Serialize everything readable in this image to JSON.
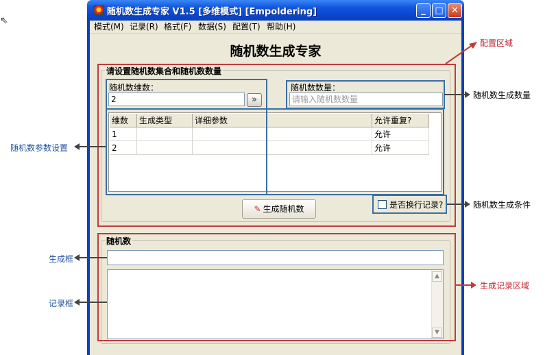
{
  "window": {
    "title": "随机数生成专家 V1.5 [多维模式] [Empoldering]",
    "min_glyph": "_",
    "max_glyph": "□",
    "close_glyph": "✕"
  },
  "menu": [
    "模式(M)",
    "记录(R)",
    "格式(F)",
    "数据(S)",
    "配置(T)",
    "帮助(H)"
  ],
  "app_title": "随机数生成专家",
  "config_group": {
    "legend": "请设置随机数集合和随机数数量",
    "dimension_label": "随机数维数：",
    "dimension_value": "2",
    "go_glyph": "»",
    "count_label": "随机数数量：",
    "count_placeholder": "请输入随机数数量"
  },
  "table": {
    "headers": [
      "维数",
      "生成类型",
      "详细参数",
      "允许重复?"
    ],
    "rows": [
      [
        "1",
        "",
        "",
        "允许"
      ],
      [
        "2",
        "",
        "",
        "允许"
      ]
    ]
  },
  "generate_button": "生成随机数",
  "generate_icon_glyph": "✎",
  "newline_checkbox": {
    "label": "是否换行记录?",
    "checked": false
  },
  "result_group": {
    "legend": "随机数"
  },
  "annotations": {
    "config_area": "配置区域",
    "count": "随机数生成数量",
    "params": "随机数参数设置",
    "condition": "随机数生成条件",
    "gen_box": "生成框",
    "record_box": "记录框",
    "record_area": "生成记录区域"
  },
  "colors": {
    "annotation_red": "#c23a3a",
    "annotation_blue": "#3b6ea5",
    "titlebar": "#0a48d0"
  }
}
